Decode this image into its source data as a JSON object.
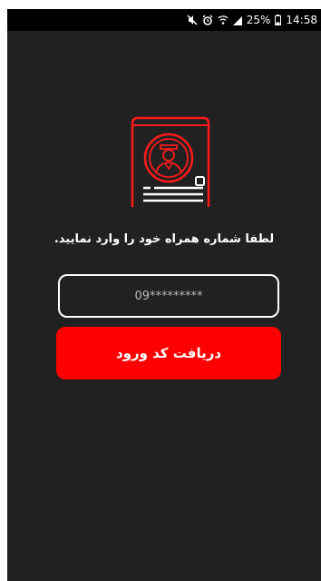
{
  "status_bar": {
    "icons": [
      "mute-icon",
      "alarm-icon",
      "wifi-icon",
      "signal-icon",
      "battery-icon"
    ],
    "battery_percent": "25%",
    "time": "14:58"
  },
  "login": {
    "logo_icon": "profile-card-icon",
    "prompt": "لطفا شماره همراه خود را وارد نمایید.",
    "phone_placeholder": "09*********",
    "submit_label": "دریافت کد ورود"
  },
  "colors": {
    "background": "#212121",
    "accent": "#ff0000",
    "text": "#ffffff"
  }
}
